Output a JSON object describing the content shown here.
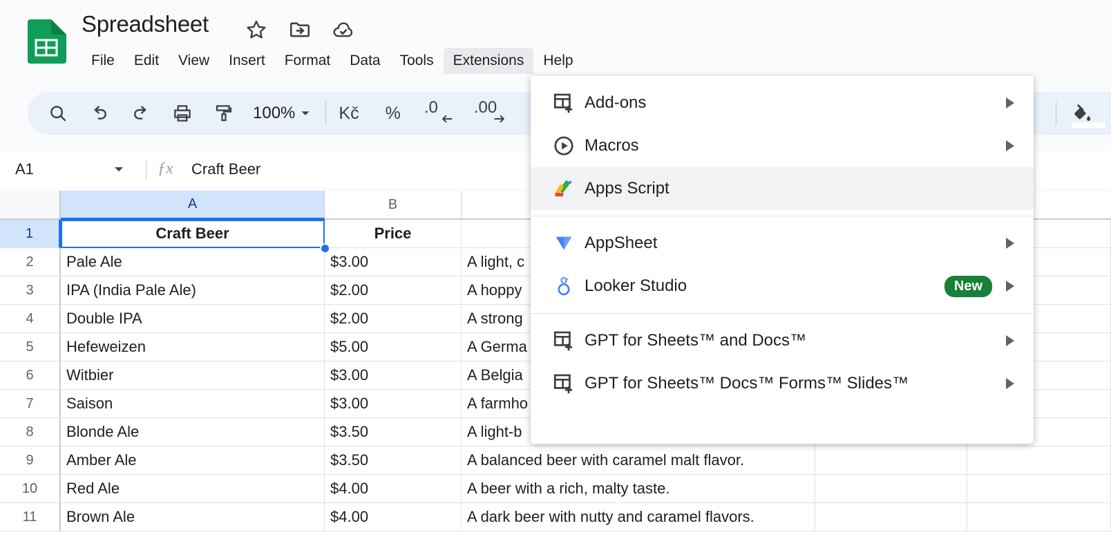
{
  "app": {
    "doc_title": "Spreadsheet",
    "logo_icon": "google-sheets-logo"
  },
  "title_icons": [
    {
      "name": "star-icon",
      "label": "Star"
    },
    {
      "name": "move-to-folder-icon",
      "label": "Move"
    },
    {
      "name": "cloud-saved-icon",
      "label": "Saved to Drive"
    }
  ],
  "menubar": {
    "items": [
      {
        "label": "File",
        "active": false
      },
      {
        "label": "Edit",
        "active": false
      },
      {
        "label": "View",
        "active": false
      },
      {
        "label": "Insert",
        "active": false
      },
      {
        "label": "Format",
        "active": false
      },
      {
        "label": "Data",
        "active": false
      },
      {
        "label": "Tools",
        "active": false
      },
      {
        "label": "Extensions",
        "active": true
      },
      {
        "label": "Help",
        "active": false
      }
    ]
  },
  "toolbar": {
    "search_icon": "search-icon",
    "undo_icon": "undo-icon",
    "redo_icon": "redo-icon",
    "print_icon": "print-icon",
    "paint_format_icon": "paint-format-icon",
    "zoom_level": "100%",
    "zoom_caret_icon": "chevron-down-icon",
    "currency_label": "Kč",
    "percent_label": "%",
    "decrease_decimal_label": ".0",
    "increase_decimal_label": ".00",
    "fill_color_icon": "fill-color-icon"
  },
  "formula_bar": {
    "name_box": "A1",
    "name_box_caret_icon": "chevron-down-icon",
    "fx_icon": "function-icon",
    "value": "Craft Beer"
  },
  "grid": {
    "columns": [
      {
        "label": "A",
        "selected": true
      },
      {
        "label": "B",
        "selected": false
      },
      {
        "label": "",
        "selected": false
      }
    ],
    "selected_cell": "A1",
    "rows": [
      {
        "num": "1",
        "a": "Craft Beer",
        "b": "Price",
        "c": "",
        "header": true,
        "selected": true
      },
      {
        "num": "2",
        "a": "Pale Ale",
        "b": "$3.00",
        "c": "A light, c",
        "header": false,
        "selected": false
      },
      {
        "num": "3",
        "a": "IPA (India Pale Ale)",
        "b": "$2.00",
        "c": "A hoppy",
        "header": false,
        "selected": false
      },
      {
        "num": "4",
        "a": "Double IPA",
        "b": "$2.00",
        "c": "A strong",
        "header": false,
        "selected": false
      },
      {
        "num": "5",
        "a": "Hefeweizen",
        "b": "$5.00",
        "c": "A Germa",
        "header": false,
        "selected": false
      },
      {
        "num": "6",
        "a": "Witbier",
        "b": "$3.00",
        "c": "A Belgia",
        "header": false,
        "selected": false
      },
      {
        "num": "7",
        "a": "Saison",
        "b": "$3.00",
        "c": "A farmho",
        "header": false,
        "selected": false
      },
      {
        "num": "8",
        "a": "Blonde Ale",
        "b": "$3.50",
        "c": "A light-b",
        "header": false,
        "selected": false
      },
      {
        "num": "9",
        "a": "Amber Ale",
        "b": "$3.50",
        "c": "A balanced beer with caramel malt flavor.",
        "header": false,
        "selected": false
      },
      {
        "num": "10",
        "a": "Red Ale",
        "b": "$4.00",
        "c": "A beer with a rich, malty taste.",
        "header": false,
        "selected": false
      },
      {
        "num": "11",
        "a": "Brown Ale",
        "b": "$4.00",
        "c": "A dark beer with nutty and caramel flavors.",
        "header": false,
        "selected": false
      }
    ]
  },
  "extensions_menu": {
    "items": [
      {
        "label": "Add-ons",
        "icon": "add-ons-icon",
        "arrow": true,
        "badge": "",
        "highlighted": false
      },
      {
        "label": "Macros",
        "icon": "macros-play-icon",
        "arrow": true,
        "badge": "",
        "highlighted": false
      },
      {
        "label": "Apps Script",
        "icon": "apps-script-icon",
        "arrow": false,
        "badge": "",
        "highlighted": true
      },
      {
        "label": "AppSheet",
        "icon": "appsheet-icon",
        "arrow": true,
        "badge": "",
        "highlighted": false
      },
      {
        "label": "Looker Studio",
        "icon": "looker-studio-icon",
        "arrow": true,
        "badge": "New",
        "highlighted": false
      },
      {
        "label": "GPT for Sheets™ and Docs™",
        "icon": "add-ons-icon",
        "arrow": true,
        "badge": "",
        "highlighted": false
      },
      {
        "label": "GPT for Sheets™ Docs™ Forms™ Slides™",
        "icon": "add-ons-icon",
        "arrow": true,
        "badge": "",
        "highlighted": false
      }
    ]
  },
  "colors": {
    "sheets_green": "#0f9d58",
    "accent_blue": "#1a73e8",
    "badge_green": "#188038",
    "toolbar_bg": "#eaf1fb",
    "header_sel": "#d2e3fc"
  }
}
